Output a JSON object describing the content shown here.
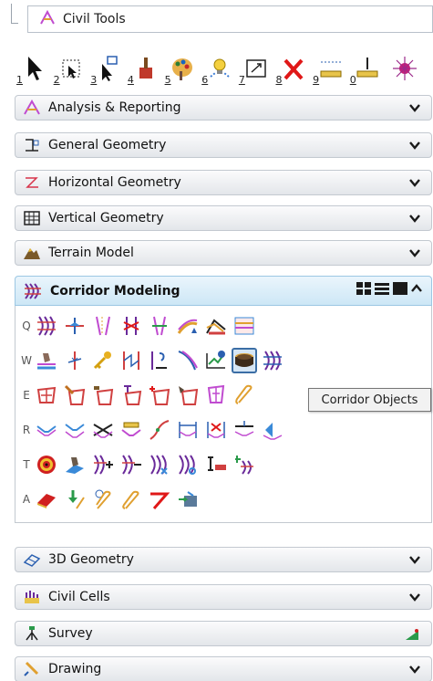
{
  "title": "Civil Tools",
  "tools": [
    {
      "num": "1",
      "icon": "select-arrow-icon"
    },
    {
      "num": "2",
      "icon": "selection-box-icon"
    },
    {
      "num": "3",
      "icon": "element-info-icon"
    },
    {
      "num": "4",
      "icon": "paint-brush-icon"
    },
    {
      "num": "5",
      "icon": "palette-icon"
    },
    {
      "num": "6",
      "icon": "lightbulb-icon"
    },
    {
      "num": "7",
      "icon": "fit-view-icon"
    },
    {
      "num": "8",
      "icon": "delete-x-icon"
    },
    {
      "num": "9",
      "icon": "measure-distance-icon"
    },
    {
      "num": "0",
      "icon": "measure-height-icon"
    },
    {
      "num": "",
      "icon": "star-burst-icon"
    }
  ],
  "panels": {
    "analysis": "Analysis & Reporting",
    "general": "General Geometry",
    "horizontal": "Horizontal Geometry",
    "vertical": "Vertical Geometry",
    "terrain": "Terrain Model",
    "corridor": "Corridor Modeling",
    "geometry3d": "3D Geometry",
    "cells": "Civil Cells",
    "survey": "Survey",
    "drawing": "Drawing"
  },
  "row_keys": [
    "Q",
    "W",
    "E",
    "R",
    "T",
    "A"
  ],
  "tooltip": "Corridor Objects",
  "colors": {
    "active_panel": "#cde7f6",
    "selection": "#3b6ea5"
  }
}
